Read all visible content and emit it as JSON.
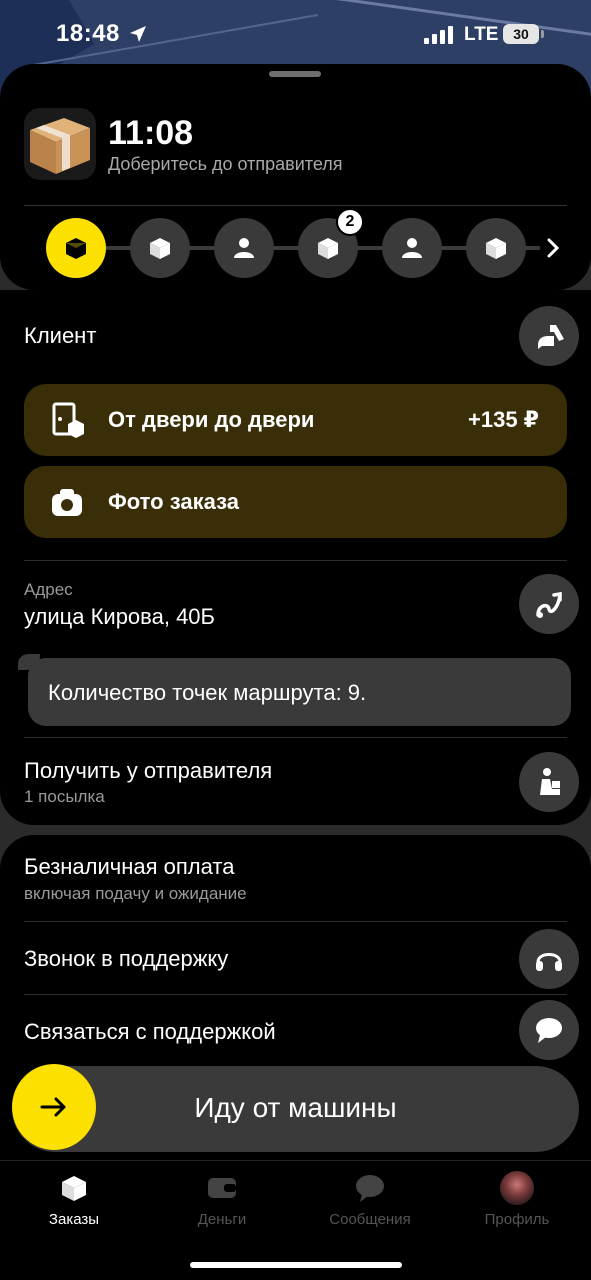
{
  "status_bar": {
    "time": "18:48",
    "network": "LTE",
    "battery": "30"
  },
  "order": {
    "time": "11:08",
    "subtitle": "Доберитесь до отправителя",
    "steps_badge": "2"
  },
  "client": {
    "title": "Клиент"
  },
  "door_to_door": {
    "label": "От двери до двери",
    "price": "+135 ₽"
  },
  "photo": {
    "label": "Фото заказа"
  },
  "address": {
    "caption": "Адрес",
    "value": "улица Кирова, 40Б"
  },
  "route_note": "Количество точек маршрута: 9.",
  "pickup": {
    "title": "Получить у отправителя",
    "sub": "1 посылка"
  },
  "payment": {
    "title": "Безналичная оплата",
    "sub": "включая подачу и ожидание"
  },
  "support_call": "Звонок в поддержку",
  "support_chat": "Связаться с поддержкой",
  "action": {
    "label": "Иду от машины"
  },
  "tabs": [
    {
      "label": "Заказы",
      "icon": "box-icon",
      "active": true
    },
    {
      "label": "Деньги",
      "icon": "wallet-icon",
      "active": false
    },
    {
      "label": "Сообщения",
      "icon": "chat-icon",
      "active": false
    },
    {
      "label": "Профиль",
      "icon": "avatar",
      "active": false
    }
  ],
  "colors": {
    "accent": "#fce000",
    "pill_bg": "#3a2e08",
    "button_bg": "#3a3a3a"
  }
}
